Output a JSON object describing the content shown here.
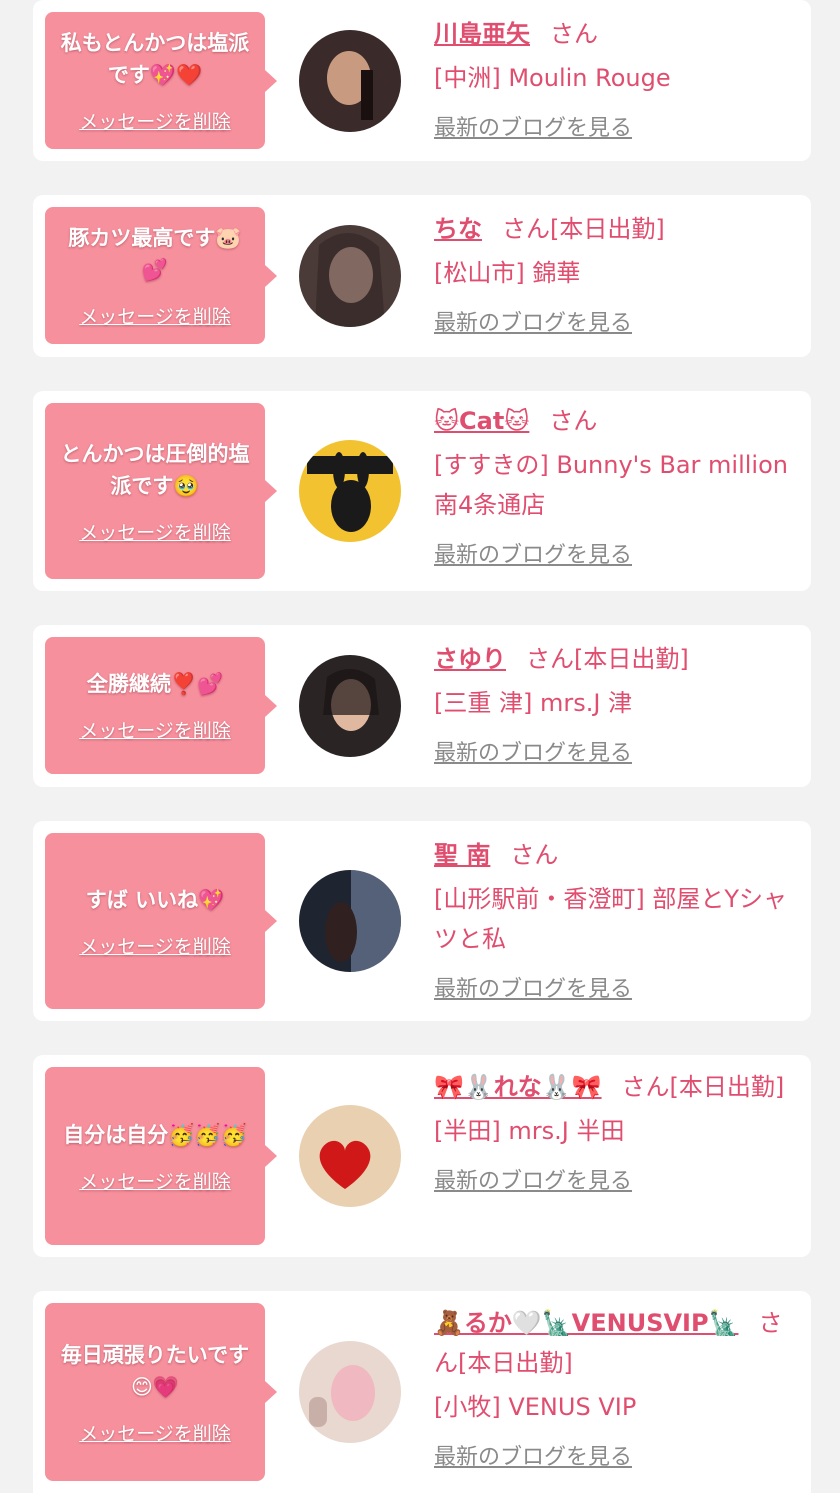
{
  "entries": [
    {
      "message": "私もとんかつは塩派です💖❤️",
      "delete_label": "メッセージを削除",
      "name": "川島亜矢",
      "suffix": "さん",
      "shop": "[中洲] Moulin Rouge",
      "blog_label": "最新のブログを見る",
      "avatar_colors": [
        "#3a2a2a",
        "#c89a80",
        "#1a1010"
      ]
    },
    {
      "message": "豚カツ最高です🐷💕",
      "delete_label": "メッセージを削除",
      "name": "ちな",
      "suffix": "さん[本日出勤]",
      "shop": "[松山市] 錦華",
      "blog_label": "最新のブログを見る",
      "avatar_colors": [
        "#4a3a38",
        "#d8b0a0",
        "#2a2020"
      ]
    },
    {
      "message": "とんかつは圧倒的塩派です🥹",
      "delete_label": "メッセージを削除",
      "name": "🐱Cat🐱",
      "suffix": "さん",
      "shop": "[すすきの] Bunny's Bar million 南4条通店",
      "blog_label": "最新のブログを見る",
      "avatar_colors": [
        "#f2c230",
        "#1a1a1a",
        "#e8a820"
      ]
    },
    {
      "message": "全勝継続❣️💕",
      "delete_label": "メッセージを削除",
      "name": "さゆり",
      "suffix": "さん[本日出勤]",
      "shop": "[三重 津] mrs.J 津",
      "blog_label": "最新のブログを見る",
      "avatar_colors": [
        "#2a2424",
        "#e0b8a0",
        "#1a1414"
      ]
    },
    {
      "message": "すば いいね💖",
      "delete_label": "メッセージを削除",
      "name": "聖 南",
      "suffix": "さん",
      "shop": "[山形駅前・香澄町] 部屋とYシャツと私",
      "blog_label": "最新のブログを見る",
      "avatar_colors": [
        "#1e2430",
        "#7a8aa8",
        "#302020"
      ]
    },
    {
      "message": "自分は自分🥳🥳🥳",
      "delete_label": "メッセージを削除",
      "name": "🎀🐰れな🐰🎀",
      "suffix": "さん[本日出勤]",
      "shop": "[半田] mrs.J 半田",
      "blog_label": "最新のブログを見る",
      "avatar_colors": [
        "#e8d0b0",
        "#d01818",
        "#f0e0c8"
      ]
    },
    {
      "message": "毎日頑張りたいです😊💗",
      "delete_label": "メッセージを削除",
      "name": "🧸るか🤍🗽VENUSVIP🗽",
      "suffix": "さん[本日出勤]",
      "shop": "[小牧] VENUS VIP",
      "blog_label": "最新のブログを見る",
      "avatar_colors": [
        "#e8d8d0",
        "#f0b8c0",
        "#c8b0a8"
      ]
    }
  ]
}
